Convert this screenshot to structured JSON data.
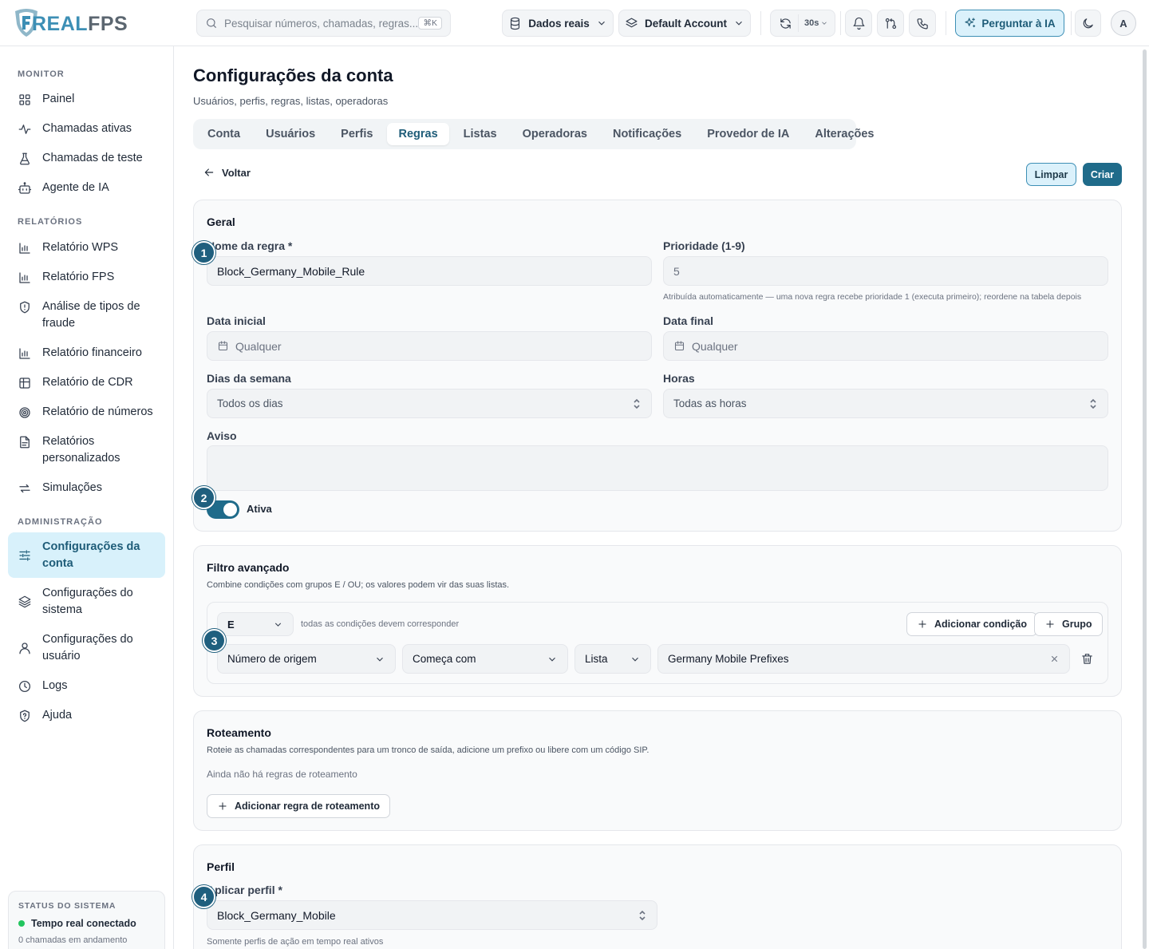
{
  "brand": {
    "name_part1": "REAL",
    "name_part2": "FPS"
  },
  "search": {
    "placeholder": "Pesquisar números, chamadas, regras...",
    "shortcut": "⌘K"
  },
  "header": {
    "data_source": "Dados reais",
    "account": "Default Account",
    "refresh_interval": "30s",
    "ai_button": "Perguntar à IA",
    "avatar_initial": "A"
  },
  "sidebar": {
    "monitor_label": "MONITOR",
    "monitor_items": [
      {
        "label": "Painel",
        "icon": "grid-icon"
      },
      {
        "label": "Chamadas ativas",
        "icon": "activity-icon"
      },
      {
        "label": "Chamadas de teste",
        "icon": "flask-icon"
      },
      {
        "label": "Agente de IA",
        "icon": "bot-icon"
      }
    ],
    "reports_label": "RELATÓRIOS",
    "report_items": [
      {
        "label": "Relatório WPS",
        "icon": "bar-chart-icon"
      },
      {
        "label": "Relatório FPS",
        "icon": "bar-chart-icon"
      },
      {
        "label": "Análise de tipos de fraude",
        "icon": "shield-icon"
      },
      {
        "label": "Relatório financeiro",
        "icon": "bar-chart-icon"
      },
      {
        "label": "Relatório de CDR",
        "icon": "table-icon"
      },
      {
        "label": "Relatório de números",
        "icon": "target-icon"
      },
      {
        "label": "Relatórios personalizados",
        "icon": "file-text-icon"
      },
      {
        "label": "Simulações",
        "icon": "repeat-icon"
      }
    ],
    "admin_label": "ADMINISTRAÇÃO",
    "admin_items": [
      {
        "label": "Configurações da conta",
        "icon": "sliders-icon",
        "active": true
      },
      {
        "label": "Configurações do sistema",
        "icon": "layers-icon"
      },
      {
        "label": "Configurações do usuário",
        "icon": "user-icon"
      },
      {
        "label": "Logs",
        "icon": "clock-icon"
      },
      {
        "label": "Ajuda",
        "icon": "help-shield-icon"
      }
    ],
    "status": {
      "title": "STATUS DO SISTEMA",
      "connection": "Tempo real conectado",
      "calls": "0 chamadas em andamento"
    }
  },
  "page": {
    "title": "Configurações da conta",
    "subtitle": "Usuários, perfis, regras, listas, operadoras",
    "tabs": [
      "Conta",
      "Usuários",
      "Perfis",
      "Regras",
      "Listas",
      "Operadoras",
      "Notificações",
      "Provedor de IA",
      "Alterações"
    ],
    "active_tab": "Regras",
    "back_label": "Voltar",
    "clear_label": "Limpar",
    "create_label": "Criar"
  },
  "general": {
    "title": "Geral",
    "rule_name_label": "Nome da regra *",
    "rule_name_value": "Block_Germany_Mobile_Rule",
    "priority_label": "Prioridade (1-9)",
    "priority_value": "5",
    "priority_hint": "Atribuída automaticamente — uma nova regra recebe prioridade 1 (executa primeiro); reordene na tabela depois",
    "start_date_label": "Data inicial",
    "start_date_placeholder": "Qualquer",
    "end_date_label": "Data final",
    "end_date_placeholder": "Qualquer",
    "weekdays_label": "Dias da semana",
    "weekdays_value": "Todos os dias",
    "hours_label": "Horas",
    "hours_value": "Todas as horas",
    "warning_label": "Aviso",
    "warning_value": "",
    "active_label": "Ativa",
    "active": true
  },
  "advanced_filter": {
    "title": "Filtro avançado",
    "description": "Combine condições com grupos E / OU; os valores podem vir das suas listas.",
    "operator": "E",
    "operator_hint": "todas as condições devem corresponder",
    "add_condition_label": "Adicionar condição",
    "add_group_label": "Grupo",
    "condition": {
      "field": "Número de origem",
      "comparator": "Começa com",
      "source": "Lista",
      "value": "Germany Mobile Prefixes"
    }
  },
  "routing": {
    "title": "Roteamento",
    "description": "Roteie as chamadas correspondentes para um tronco de saída, adicione um prefixo ou libere com um código SIP.",
    "empty_text": "Ainda não há regras de roteamento",
    "add_label": "Adicionar regra de roteamento"
  },
  "profile": {
    "title": "Perfil",
    "apply_label": "Aplicar perfil *",
    "apply_value": "Block_Germany_Mobile",
    "hint": "Somente perfis de ação em tempo real ativos"
  },
  "steps": [
    "1",
    "2",
    "3",
    "4"
  ],
  "colors": {
    "accent": "#1f6b8a",
    "accent_light": "#dbf1fb",
    "status_ok": "#22c55e",
    "brand_blue": "#3d8fb5"
  }
}
